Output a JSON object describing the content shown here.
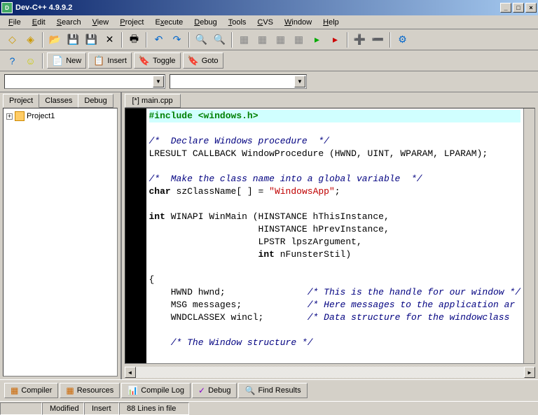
{
  "title": "Dev-C++ 4.9.9.2",
  "menu": [
    "File",
    "Edit",
    "Search",
    "View",
    "Project",
    "Execute",
    "Debug",
    "Tools",
    "CVS",
    "Window",
    "Help"
  ],
  "toolbar2": {
    "new": "New",
    "insert": "Insert",
    "toggle": "Toggle",
    "goto": "Goto"
  },
  "leftTabs": [
    "Project",
    "Classes",
    "Debug"
  ],
  "projectName": "Project1",
  "fileTab": "[*] main.cpp",
  "code": {
    "l1a": "#include ",
    "l1b": "<windows.h>",
    "l2": "/*  Declare Windows procedure  */",
    "l3": "LRESULT CALLBACK WindowProcedure (HWND, UINT, WPARAM, LPARAM);",
    "l4": "/*  Make the class name into a global variable  */",
    "l5a": "char",
    "l5b": " szClassName[ ] = ",
    "l5c": "\"WindowsApp\"",
    "l5d": ";",
    "l6a": "int",
    "l6b": " WINAPI WinMain (HINSTANCE hThisInstance,",
    "l7": "                    HINSTANCE hPrevInstance,",
    "l8": "                    LPSTR lpszArgument,",
    "l9a": "                    ",
    "l9b": "int",
    "l9c": " nFunsterStil)",
    "l10": "{",
    "l11a": "    HWND hwnd;               ",
    "l11b": "/* This is the handle for our window */",
    "l12a": "    MSG messages;            ",
    "l12b": "/* Here messages to the application ar",
    "l13a": "    WNDCLASSEX wincl;        ",
    "l13b": "/* Data structure for the windowclass",
    "l14": "    /* The Window structure */"
  },
  "bottomTabs": [
    "Compiler",
    "Resources",
    "Compile Log",
    "Debug",
    "Find Results"
  ],
  "status": {
    "modified": "Modified",
    "insert": "Insert",
    "lines": "88 Lines in file"
  }
}
